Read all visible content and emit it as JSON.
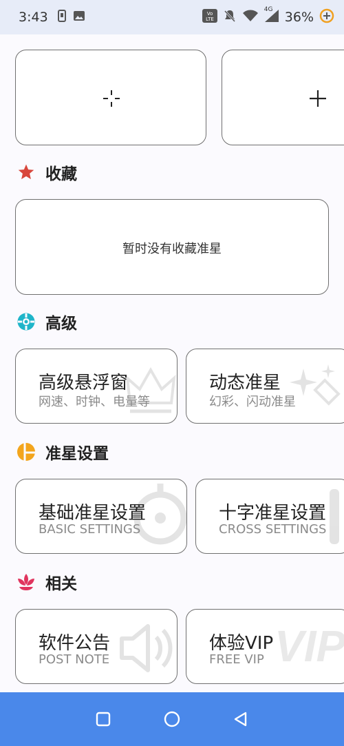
{
  "status": {
    "time": "3:43",
    "battery_percent": "36%",
    "network": "4G",
    "icons": [
      "sim-icon",
      "image-icon",
      "volte-icon",
      "mute-icon",
      "wifi-icon",
      "signal-icon",
      "battery-saver-icon"
    ]
  },
  "crosshair_slots": [
    {
      "icon": "crosshair-icon"
    },
    {
      "icon": "plus-icon"
    }
  ],
  "favorites": {
    "title": "收藏",
    "empty_text": "暂时没有收藏准星"
  },
  "advanced": {
    "title": "高级",
    "cards": [
      {
        "title": "高级悬浮窗",
        "subtitle": "网速、时钟、电量等"
      },
      {
        "title": "动态准星",
        "subtitle": "幻彩、闪动准星"
      }
    ]
  },
  "settings": {
    "title": "准星设置",
    "cards": [
      {
        "title": "基础准星设置",
        "subtitle": "BASIC SETTINGS"
      },
      {
        "title": "十字准星设置",
        "subtitle": "CROSS SETTINGS"
      }
    ]
  },
  "related": {
    "title": "相关",
    "cards": [
      {
        "title": "软件公告",
        "subtitle": "POST NOTE"
      },
      {
        "title": "体验VIP",
        "subtitle": "FREE VIP",
        "deco": "VIP"
      }
    ]
  },
  "colors": {
    "favorites_icon": "#d8473c",
    "advanced_icon": "#1fb5c9",
    "settings_icon": "#f3a51d",
    "related_icon": "#e0345e",
    "navbar": "#4a88ea"
  }
}
